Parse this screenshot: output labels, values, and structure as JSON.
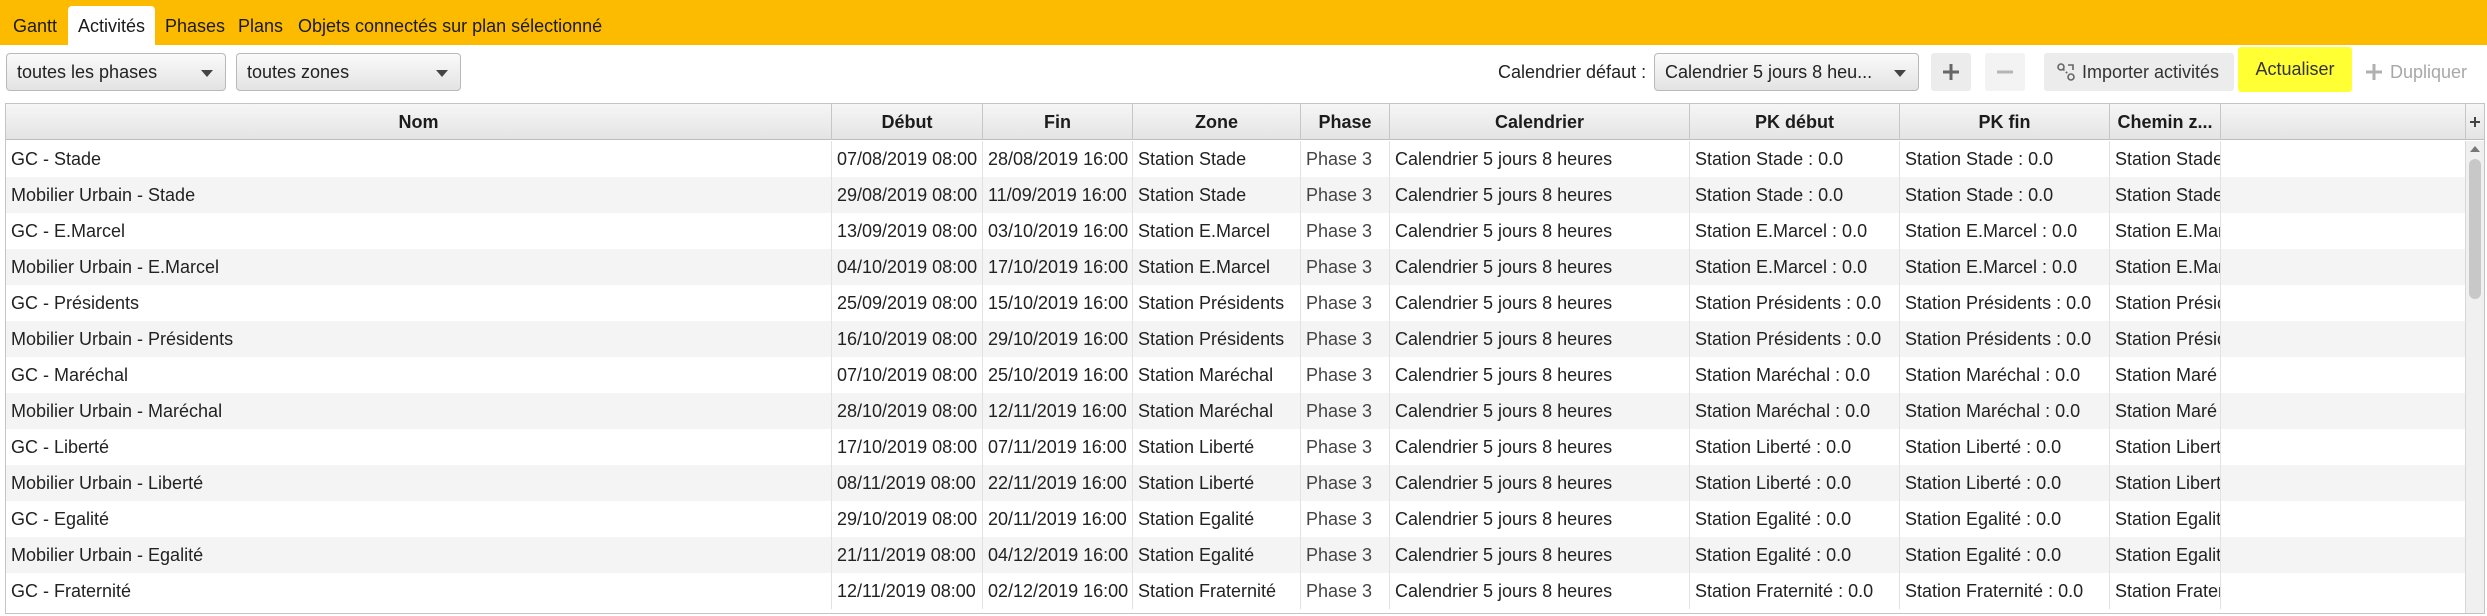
{
  "tabs": [
    {
      "label": "Gantt",
      "active": false
    },
    {
      "label": "Activités",
      "active": true
    },
    {
      "label": "Phases",
      "active": false
    },
    {
      "label": "Plans",
      "active": false
    },
    {
      "label": "Objets connectés sur plan sélectionné",
      "active": false
    }
  ],
  "toolbar": {
    "phase_filter": "toutes les phases",
    "zone_filter": "toutes zones",
    "calendar_label": "Calendrier défaut :",
    "calendar_value": "Calendrier 5 jours 8 heu...",
    "import_label": "Importer activités",
    "refresh_label": "Actualiser",
    "duplicate_label": "Dupliquer"
  },
  "colors": {
    "tabbar": "#fdbb00",
    "highlight": "#ffff33"
  },
  "table": {
    "columns": [
      "Nom",
      "Début",
      "Fin",
      "Zone",
      "Phase",
      "Calendrier",
      "PK début",
      "PK fin",
      "Chemin z..."
    ],
    "rows": [
      [
        "GC - Stade",
        "07/08/2019 08:00",
        "28/08/2019 16:00",
        "Station Stade",
        "Phase 3",
        "Calendrier 5 jours 8 heures",
        "Station Stade : 0.0",
        "Station Stade : 0.0",
        "Station Stade"
      ],
      [
        "Mobilier Urbain - Stade",
        "29/08/2019 08:00",
        "11/09/2019 16:00",
        "Station Stade",
        "Phase 3",
        "Calendrier 5 jours 8 heures",
        "Station Stade : 0.0",
        "Station Stade : 0.0",
        "Station Stade"
      ],
      [
        "GC - E.Marcel",
        "13/09/2019 08:00",
        "03/10/2019 16:00",
        "Station E.Marcel",
        "Phase 3",
        "Calendrier 5 jours 8 heures",
        "Station E.Marcel : 0.0",
        "Station E.Marcel : 0.0",
        "Station E.Mar"
      ],
      [
        "Mobilier Urbain - E.Marcel",
        "04/10/2019 08:00",
        "17/10/2019 16:00",
        "Station E.Marcel",
        "Phase 3",
        "Calendrier 5 jours 8 heures",
        "Station E.Marcel : 0.0",
        "Station E.Marcel : 0.0",
        "Station E.Mar"
      ],
      [
        "GC - Présidents",
        "25/09/2019 08:00",
        "15/10/2019 16:00",
        "Station Présidents",
        "Phase 3",
        "Calendrier 5 jours 8 heures",
        "Station Présidents : 0.0",
        "Station Présidents : 0.0",
        "Station Présic"
      ],
      [
        "Mobilier Urbain - Présidents",
        "16/10/2019 08:00",
        "29/10/2019 16:00",
        "Station Présidents",
        "Phase 3",
        "Calendrier 5 jours 8 heures",
        "Station Présidents : 0.0",
        "Station Présidents : 0.0",
        "Station Présic"
      ],
      [
        "GC - Maréchal",
        "07/10/2019 08:00",
        "25/10/2019 16:00",
        "Station Maréchal",
        "Phase 3",
        "Calendrier 5 jours 8 heures",
        "Station Maréchal : 0.0",
        "Station Maréchal : 0.0",
        "Station Maré"
      ],
      [
        "Mobilier Urbain - Maréchal",
        "28/10/2019 08:00",
        "12/11/2019 16:00",
        "Station Maréchal",
        "Phase 3",
        "Calendrier 5 jours 8 heures",
        "Station Maréchal : 0.0",
        "Station Maréchal : 0.0",
        "Station Maré"
      ],
      [
        "GC - Liberté",
        "17/10/2019 08:00",
        "07/11/2019 16:00",
        "Station Liberté",
        "Phase 3",
        "Calendrier 5 jours 8 heures",
        "Station Liberté : 0.0",
        "Station Liberté : 0.0",
        "Station Libert"
      ],
      [
        "Mobilier Urbain - Liberté",
        "08/11/2019 08:00",
        "22/11/2019 16:00",
        "Station Liberté",
        "Phase 3",
        "Calendrier 5 jours 8 heures",
        "Station Liberté : 0.0",
        "Station Liberté : 0.0",
        "Station Libert"
      ],
      [
        "GC - Egalité",
        "29/10/2019 08:00",
        "20/11/2019 16:00",
        "Station Egalité",
        "Phase 3",
        "Calendrier 5 jours 8 heures",
        "Station Egalité : 0.0",
        "Station Egalité : 0.0",
        "Station Egalit"
      ],
      [
        "Mobilier Urbain - Egalité",
        "21/11/2019 08:00",
        "04/12/2019 16:00",
        "Station Egalité",
        "Phase 3",
        "Calendrier 5 jours 8 heures",
        "Station Egalité : 0.0",
        "Station Egalité : 0.0",
        "Station Egalit"
      ],
      [
        "GC - Fraternité",
        "12/11/2019 08:00",
        "02/12/2019 16:00",
        "Station Fraternité",
        "Phase 3",
        "Calendrier 5 jours 8 heures",
        "Station Fraternité : 0.0",
        "Station Fraternité : 0.0",
        "Station Frater"
      ]
    ]
  }
}
